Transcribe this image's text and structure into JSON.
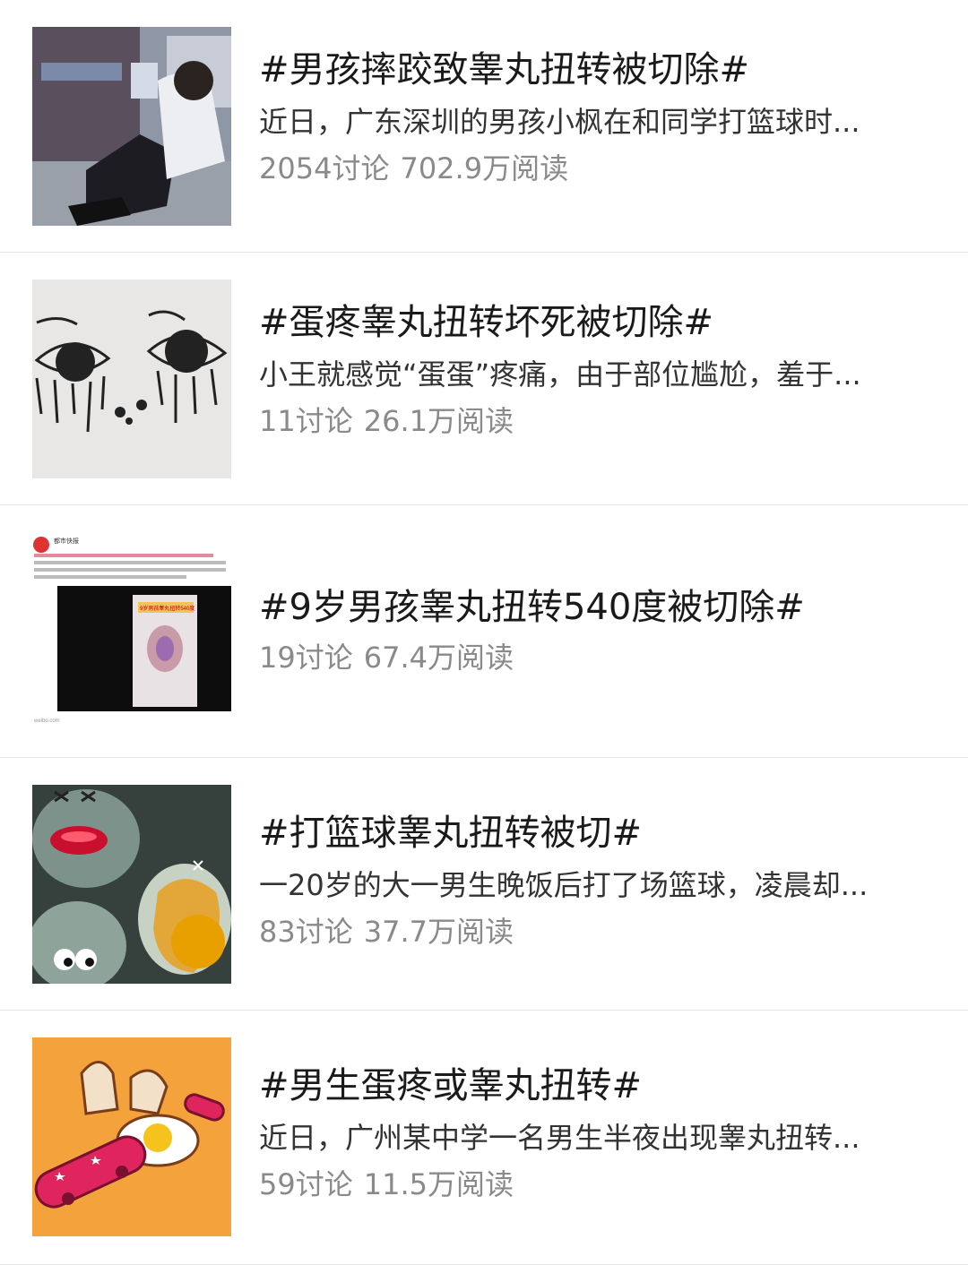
{
  "topics": [
    {
      "title": "#男孩摔跤致睾丸扭转被切除#",
      "summary": "近日，广东深圳的男孩小枫在和同学打篮球时...",
      "discussions": "2054讨论",
      "reads": "702.9万阅读",
      "thumbnail_icon": "hospital-waiting-photo"
    },
    {
      "title": "#蛋疼睾丸扭转坏死被切除#",
      "summary": "小王就感觉“蛋蛋”疼痛，由于部位尴尬，羞于...",
      "discussions": "11讨论",
      "reads": "26.1万阅读",
      "thumbnail_icon": "crying-eyes-drawing"
    },
    {
      "title": "#9岁男孩睾丸扭转540度被切除#",
      "summary": "",
      "discussions": "19讨论",
      "reads": "67.4万阅读",
      "thumbnail_icon": "weibo-post-screenshot",
      "thumbnail_text": {
        "account": "都市快报",
        "banner": "9岁男孩睾丸扭转540度",
        "footer": "weibo.com"
      }
    },
    {
      "title": "#打篮球睾丸扭转被切#",
      "summary": "一20岁的大一男生晚饭后打了场篮球，凌晨却...",
      "discussions": "83讨论",
      "reads": "37.7万阅读",
      "thumbnail_icon": "cracked-eggs-illustration"
    },
    {
      "title": "#男生蛋疼或睾丸扭转#",
      "summary": "近日，广州某中学一名男生半夜出现睾丸扭转...",
      "discussions": "59讨论",
      "reads": "11.5万阅读",
      "thumbnail_icon": "broken-egg-skateboard-illustration"
    }
  ]
}
